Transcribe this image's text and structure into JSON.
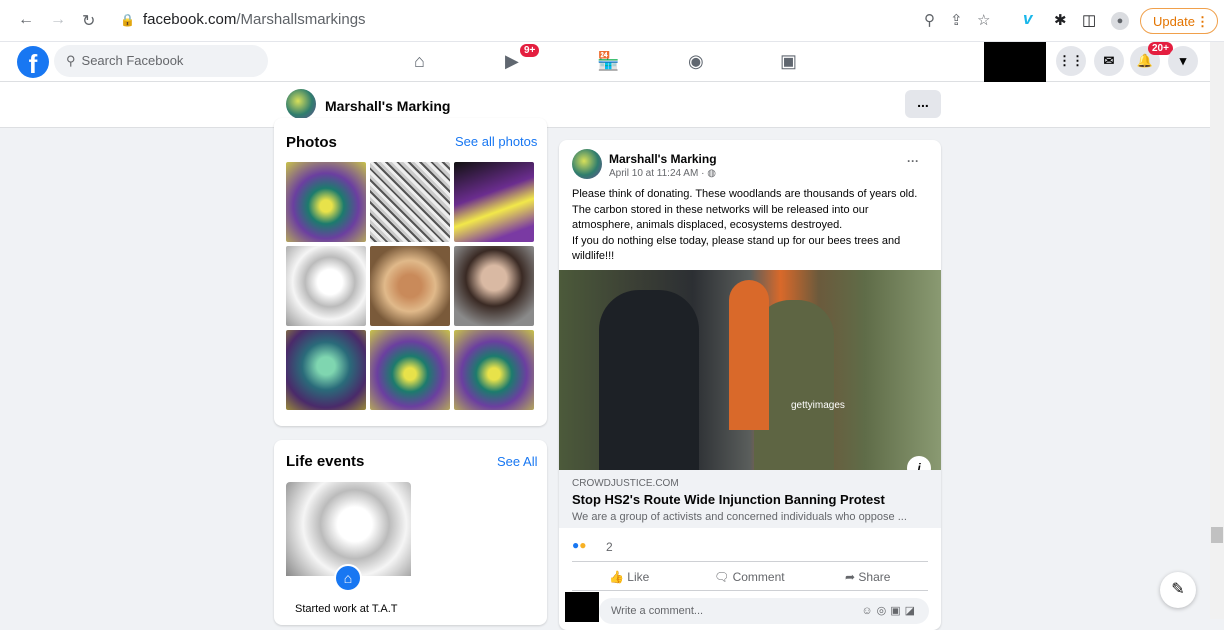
{
  "browser": {
    "back_icon": "arrow-left-icon",
    "url_host": "facebook.com",
    "url_path": "/Marshallsmarkings",
    "update_label": "Update"
  },
  "header": {
    "search_placeholder": "Search Facebook",
    "watch_badge": "9+",
    "notifications_badge": "20+"
  },
  "page": {
    "name": "Marshall's Marking",
    "more_label": "..."
  },
  "photos": {
    "title": "Photos",
    "see_all": "See all photos"
  },
  "life_events": {
    "title": "Life events",
    "see_all": "See All",
    "item_label": "Started work at T.A.T"
  },
  "post": {
    "author": "Marshall's Marking",
    "time": "April 10 at 11:24 AM ·",
    "text_1": "Please think of donating. These woodlands are thousands of years old. The carbon stored in these networks will be released into our atmosphere, animals displaced, ecosystems destroyed.",
    "text_2": "If you do nothing else today, please stand up for our bees trees and wildlife!!!",
    "watermark": "gettyimages",
    "link_domain": "CROWDJUSTICE.COM",
    "link_title": "Stop HS2's Route Wide Injunction Banning Protest",
    "link_desc": "We are a group of activists and concerned individuals who oppose ...",
    "reaction_count": "2",
    "like_label": "Like",
    "comment_label": "Comment",
    "share_label": "Share",
    "comment_placeholder": "Write a comment..."
  },
  "colors": {
    "fb_blue": "#1877f2",
    "badge_red": "#e41e3f",
    "update_orange": "#e37400"
  }
}
